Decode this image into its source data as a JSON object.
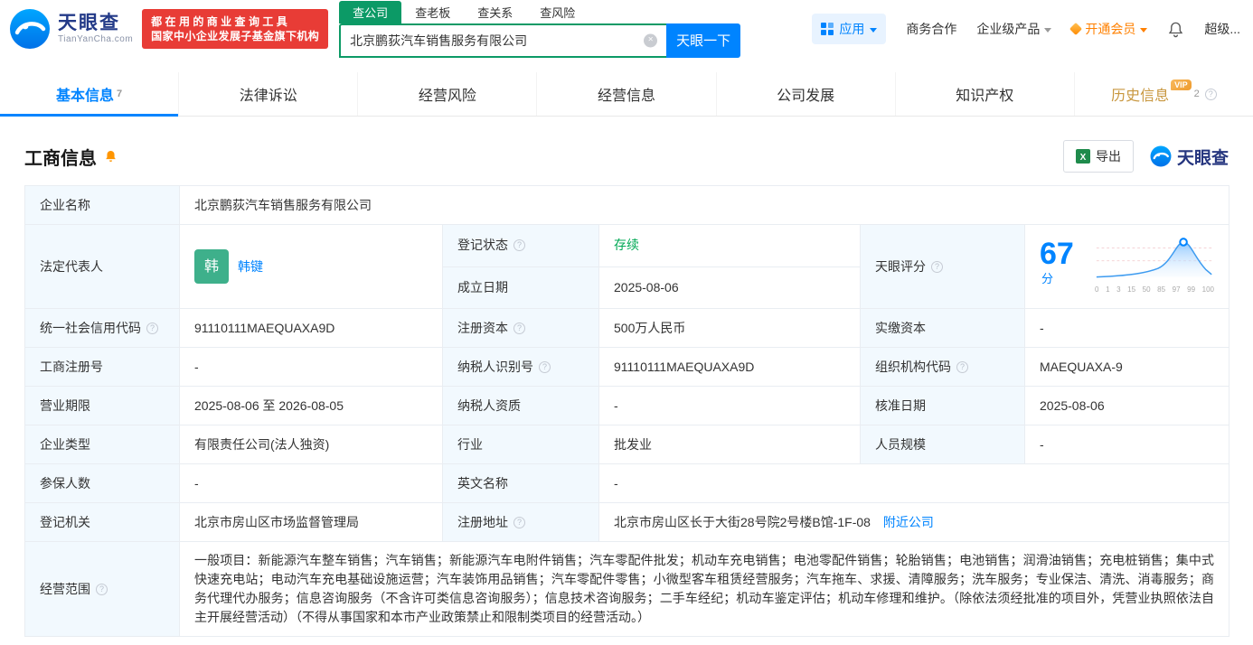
{
  "brand": {
    "name_cn": "天眼查",
    "name_en": "TianYanCha.com",
    "slogan1": "都在用的商业查询工具",
    "slogan2": "国家中小企业发展子基金旗下机构",
    "watermark": "天眼查"
  },
  "colors": {
    "accent_blue": "#0084ff",
    "search_teal": "#0c9a66",
    "status_green": "#00a854",
    "vip_gold": "#c8973f",
    "member_orange": "#ff8000",
    "slogan_red": "#e83c36"
  },
  "icons": {
    "help": "?",
    "clear": "×",
    "excel": "X"
  },
  "search": {
    "tabs": [
      "查公司",
      "查老板",
      "查关系",
      "查风险"
    ],
    "value": "北京鹏荻汽车销售服务有限公司",
    "button": "天眼一下"
  },
  "topnav": {
    "apps": "应用",
    "coop": "商务合作",
    "enterprise": "企业级产品",
    "vip": "开通会员",
    "more": "超级..."
  },
  "tabs": [
    {
      "label": "基本信息",
      "sup": "7"
    },
    {
      "label": "法律诉讼"
    },
    {
      "label": "经营风险"
    },
    {
      "label": "经营信息"
    },
    {
      "label": "公司发展"
    },
    {
      "label": "知识产权"
    },
    {
      "label": "历史信息",
      "sup": "2",
      "badge": "VIP"
    }
  ],
  "section": {
    "title": "工商信息",
    "export": "导出"
  },
  "score_chart": {
    "type": "area",
    "score": "67",
    "unit": "分",
    "ticks": [
      "0",
      "1",
      "3",
      "15",
      "50",
      "85",
      "97",
      "99",
      "100"
    ]
  },
  "fields": {
    "company_name": {
      "label": "企业名称",
      "value": "北京鹏荻汽车销售服务有限公司"
    },
    "legal_rep": {
      "label": "法定代表人",
      "avatar": "韩",
      "value": "韩键"
    },
    "reg_status": {
      "label": "登记状态",
      "value": "存续"
    },
    "establish_date": {
      "label": "成立日期",
      "value": "2025-08-06"
    },
    "score": {
      "label": "天眼评分"
    },
    "credit_code": {
      "label": "统一社会信用代码",
      "value": "91110111MAEQUAXA9D"
    },
    "reg_capital": {
      "label": "注册资本",
      "value": "500万人民币"
    },
    "paid_capital": {
      "label": "实缴资本",
      "value": "-"
    },
    "reg_no": {
      "label": "工商注册号",
      "value": "-"
    },
    "taxpayer_no": {
      "label": "纳税人识别号",
      "value": "91110111MAEQUAXA9D"
    },
    "org_code": {
      "label": "组织机构代码",
      "value": "MAEQUAXA-9"
    },
    "term": {
      "label": "营业期限",
      "value": "2025-08-06 至 2026-08-05"
    },
    "taxpayer_quality": {
      "label": "纳税人资质",
      "value": "-"
    },
    "approve_date": {
      "label": "核准日期",
      "value": "2025-08-06"
    },
    "company_type": {
      "label": "企业类型",
      "value": "有限责任公司(法人独资)"
    },
    "industry": {
      "label": "行业",
      "value": "批发业"
    },
    "staff_size": {
      "label": "人员规模",
      "value": "-"
    },
    "insured": {
      "label": "参保人数",
      "value": "-"
    },
    "english_name": {
      "label": "英文名称",
      "value": "-"
    },
    "authority": {
      "label": "登记机关",
      "value": "北京市房山区市场监督管理局"
    },
    "address": {
      "label": "注册地址",
      "value": "北京市房山区长于大街28号院2号楼B馆-1F-08",
      "link": "附近公司"
    },
    "scope": {
      "label": "经营范围",
      "value": "一般项目：新能源汽车整车销售；汽车销售；新能源汽车电附件销售；汽车零配件批发；机动车充电销售；电池零配件销售；轮胎销售；电池销售；润滑油销售；充电桩销售；集中式快速充电站；电动汽车充电基础设施运营；汽车装饰用品销售；汽车零配件零售；小微型客车租赁经营服务；汽车拖车、求援、清障服务；洗车服务；专业保洁、清洗、消毒服务；商务代理代办服务；信息咨询服务（不含许可类信息咨询服务）；信息技术咨询服务；二手车经纪；机动车鉴定评估；机动车修理和维护。（除依法须经批准的项目外，凭营业执照依法自主开展经营活动）（不得从事国家和本市产业政策禁止和限制类项目的经营活动。）"
    }
  }
}
